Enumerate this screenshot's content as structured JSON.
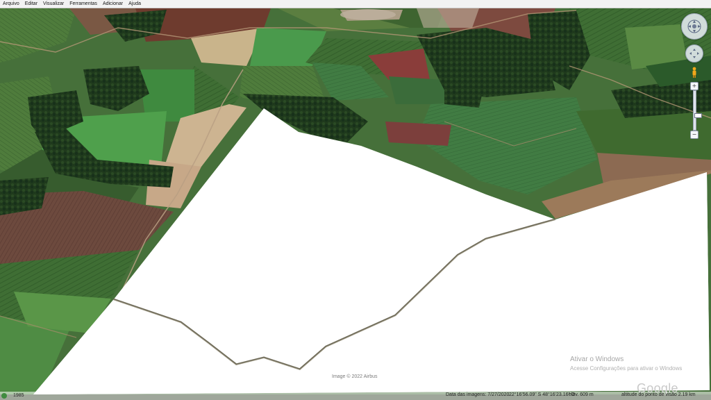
{
  "menubar": {
    "items": [
      "Arquivo",
      "Editar",
      "Visualizar",
      "Ferramentas",
      "Adicionar",
      "Ajuda"
    ]
  },
  "map": {
    "image_credit": "Image © 2022 Airbus",
    "watermark_title": "Ativar o Windows",
    "watermark_subtitle": "Acesse Configurações para ativar o Windows",
    "logo": "Google Earth"
  },
  "status": {
    "year": "1985",
    "imagery_date": "Data das imagens: 7/27/2020",
    "coordinates": "22°16'56.09\" S   48°16'23.16\" O",
    "elevation": "elev.   609 m",
    "eye_altitude": "altitude do ponto de visão   2.19 km"
  },
  "icons": {
    "look": "look-around-icon",
    "move": "move-icon",
    "pegman": "pegman-icon",
    "zoom_in": "+",
    "zoom_out": "−"
  }
}
